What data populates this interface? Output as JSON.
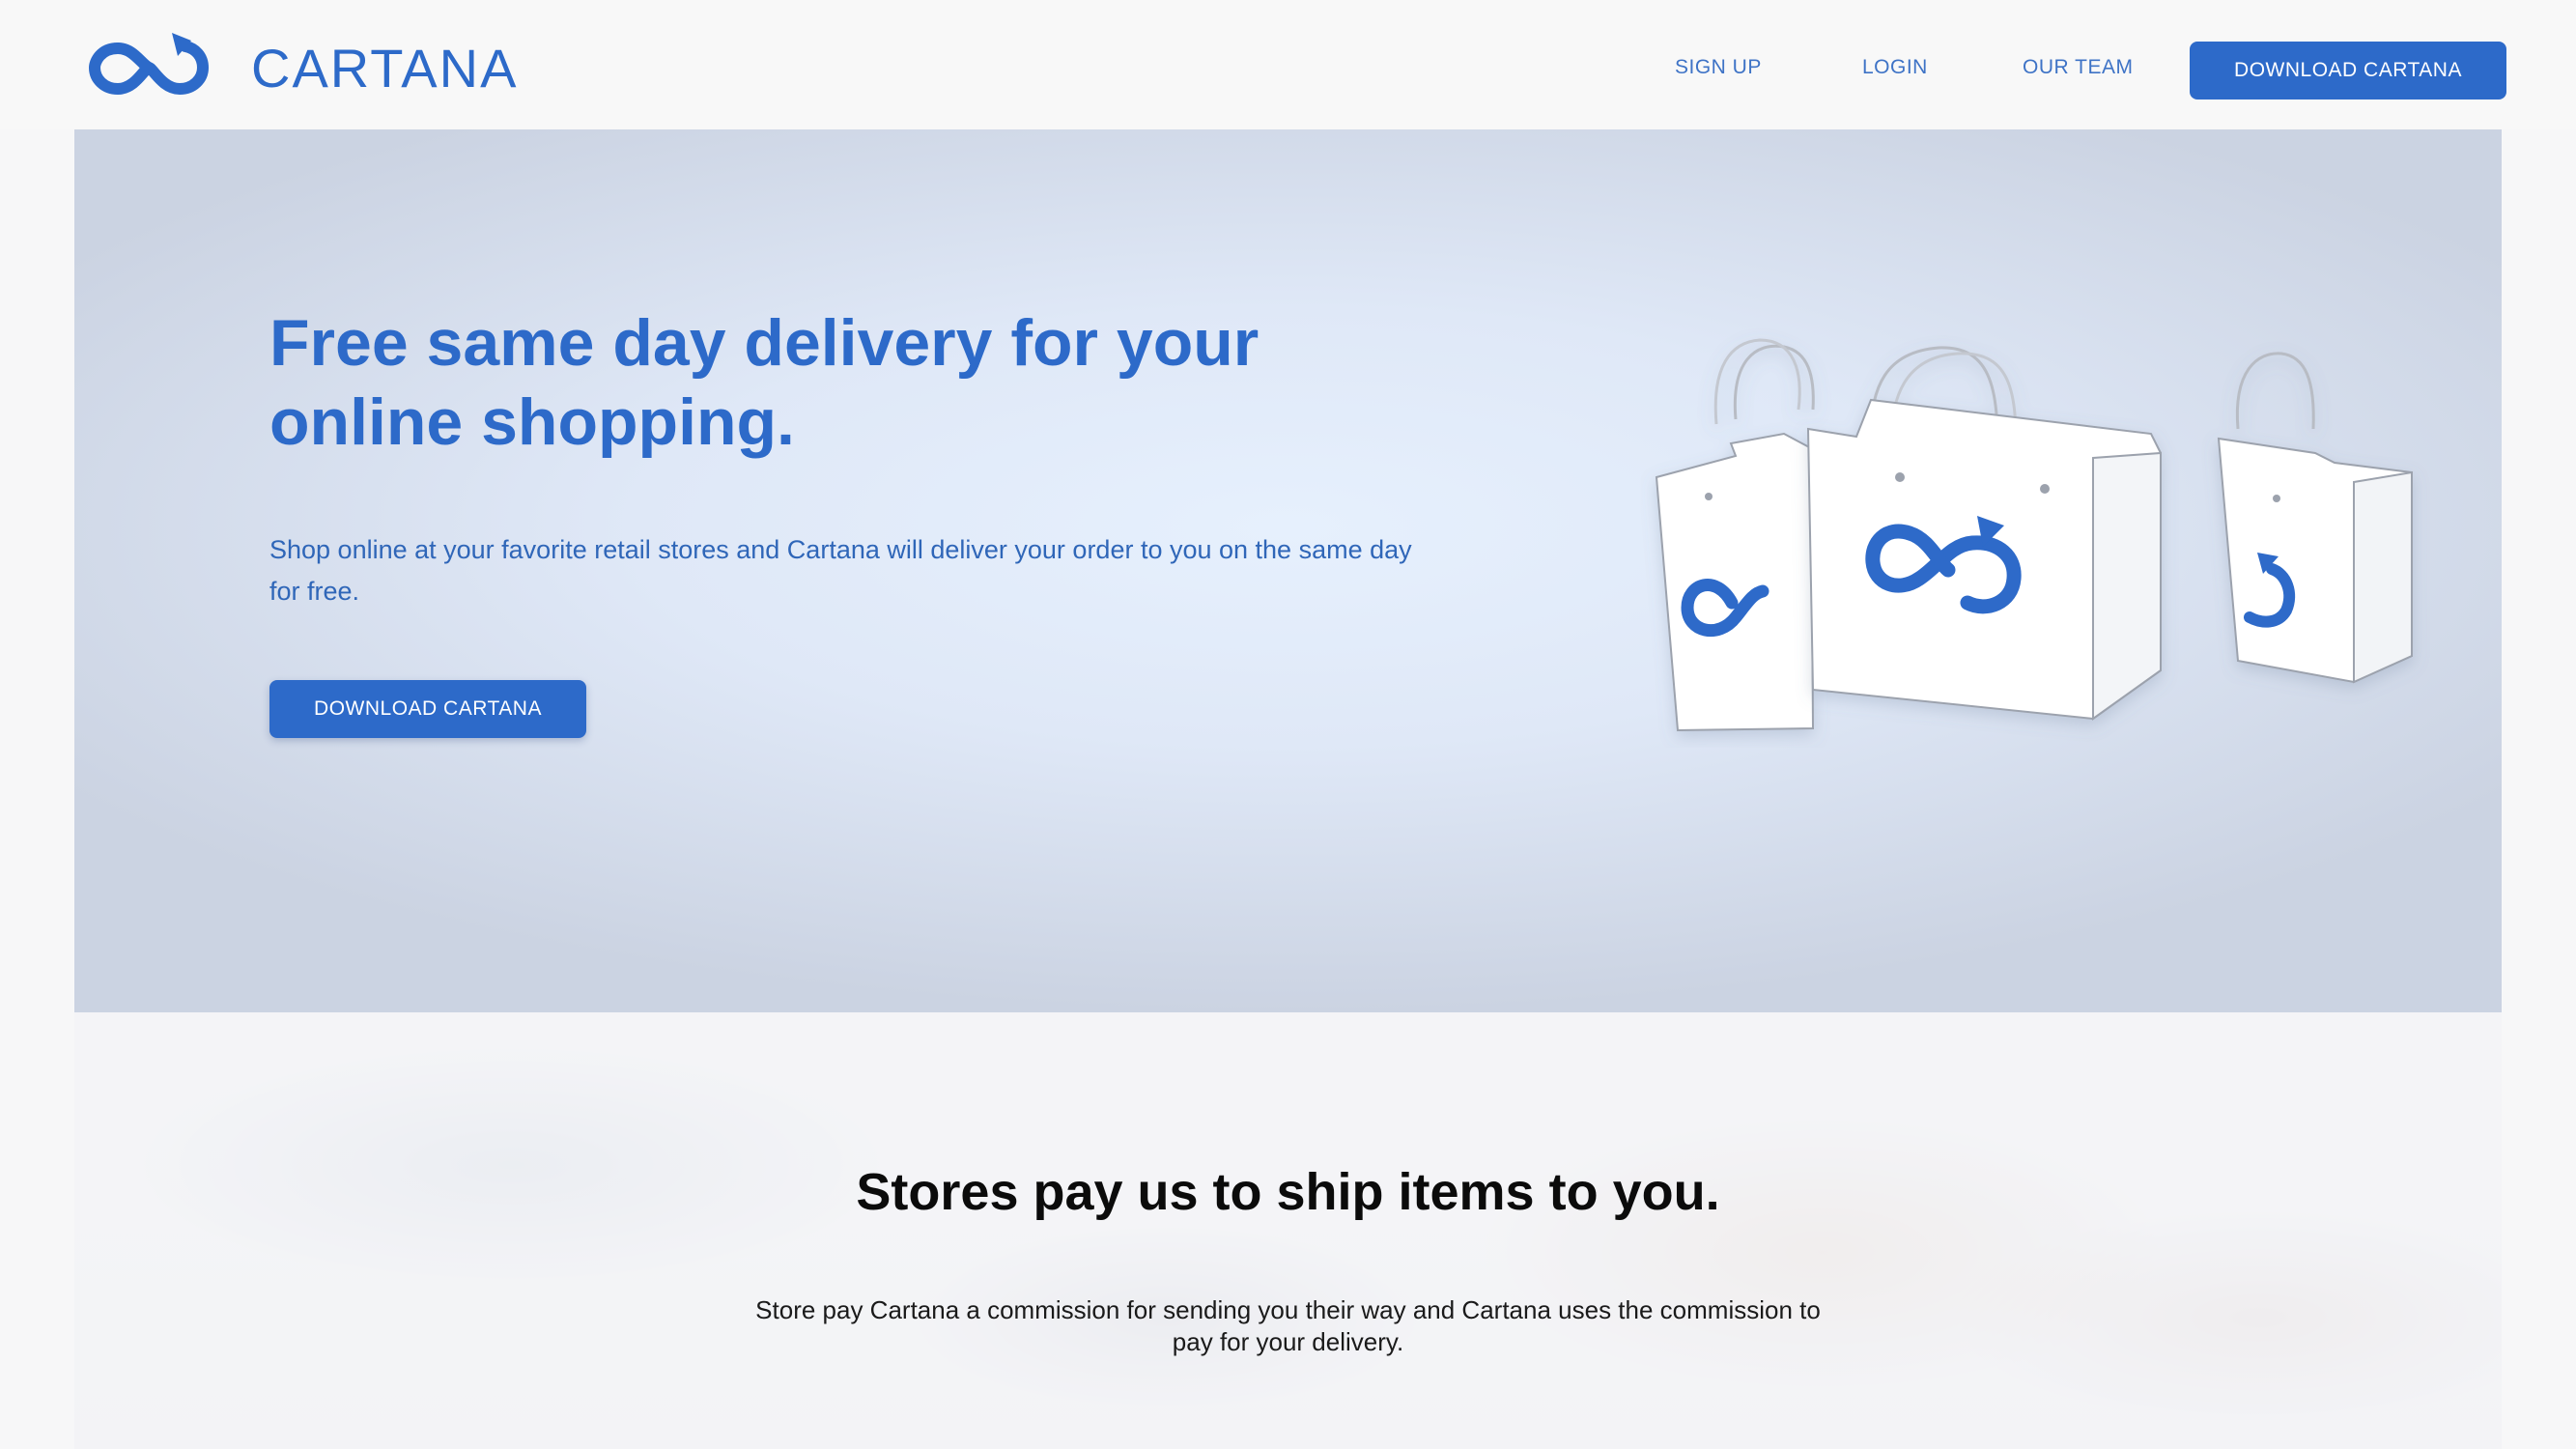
{
  "brand": {
    "name": "CARTANA",
    "logo_icon": "infinity-arrow-icon",
    "color_primary": "#2d6ac9"
  },
  "nav": {
    "sign_up": "SIGN UP",
    "login": "LOGIN",
    "our_team": "OUR TEAM",
    "download": "DOWNLOAD CARTANA"
  },
  "hero": {
    "title": "Free same day delivery for your online shopping.",
    "subtitle": "Shop online at your favorite retail stores and Cartana will deliver your order to you on the same day for free.",
    "cta": "DOWNLOAD CARTANA",
    "illustration_icon": "shopping-bags-icon"
  },
  "info": {
    "title": "Stores pay us to ship items to you.",
    "text": "Store pay Cartana a commission for sending you their way and Cartana uses the commission to pay for your delivery."
  }
}
